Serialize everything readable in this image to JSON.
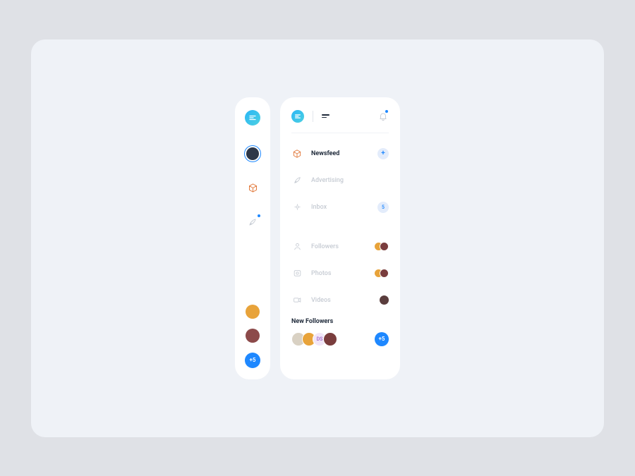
{
  "rail": {
    "plus_label": "+5"
  },
  "header": {},
  "menu": {
    "newsfeed": {
      "label": "Newsfeed",
      "badge": "+"
    },
    "advertising": {
      "label": "Advertising"
    },
    "inbox": {
      "label": "Inbox",
      "badge": "5"
    },
    "followers": {
      "label": "Followers"
    },
    "photos": {
      "label": "Photos"
    },
    "videos": {
      "label": "Videos"
    }
  },
  "new_followers": {
    "title": "New Followers",
    "initials": "DS",
    "more": "+5"
  }
}
